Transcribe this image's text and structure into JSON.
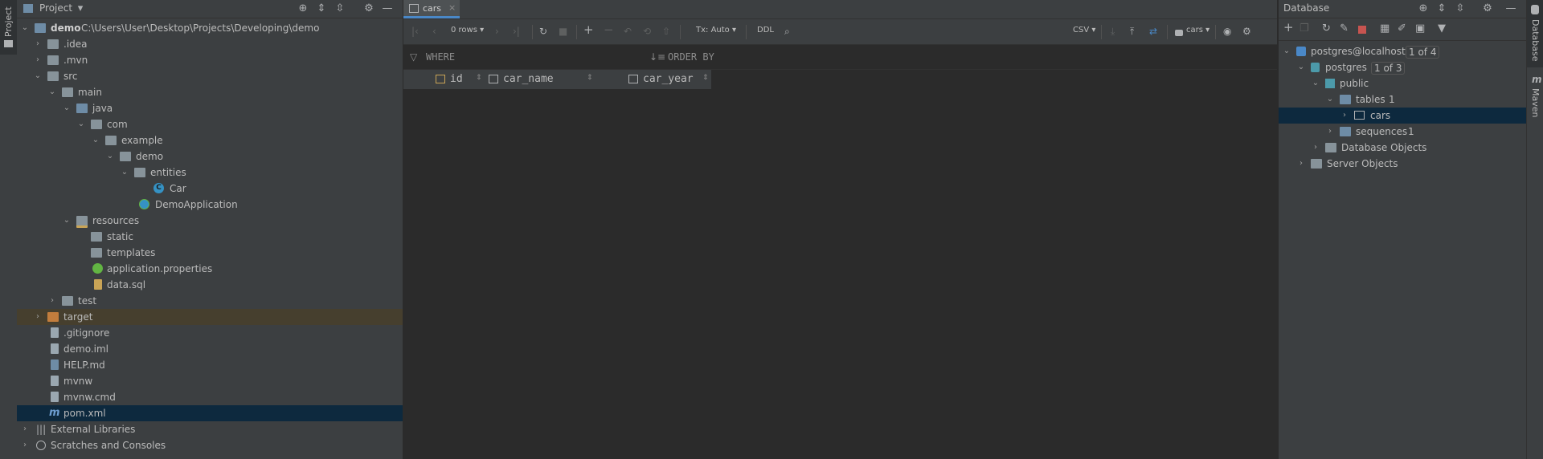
{
  "left_stripe": {
    "project_tab": "Project"
  },
  "project": {
    "title": "Project",
    "tree": [
      {
        "label": "demo",
        "hint": "C:\\Users\\User\\Desktop\\Projects\\Developing\\demo"
      },
      {
        "label": ".idea"
      },
      {
        "label": ".mvn"
      },
      {
        "label": "src"
      },
      {
        "label": "main"
      },
      {
        "label": "java"
      },
      {
        "label": "com"
      },
      {
        "label": "example"
      },
      {
        "label": "demo"
      },
      {
        "label": "entities"
      },
      {
        "label": "Car"
      },
      {
        "label": "DemoApplication"
      },
      {
        "label": "resources"
      },
      {
        "label": "static"
      },
      {
        "label": "templates"
      },
      {
        "label": "application.properties"
      },
      {
        "label": "data.sql"
      },
      {
        "label": "test"
      },
      {
        "label": "target"
      },
      {
        "label": ".gitignore"
      },
      {
        "label": "demo.iml"
      },
      {
        "label": "HELP.md"
      },
      {
        "label": "mvnw"
      },
      {
        "label": "mvnw.cmd"
      },
      {
        "label": "pom.xml"
      },
      {
        "label": "External Libraries"
      },
      {
        "label": "Scratches and Consoles"
      }
    ]
  },
  "editor": {
    "tab_label": "cars",
    "toolbar": {
      "rows": "0 rows",
      "tx": "Tx: Auto",
      "ddl": "DDL",
      "csv": "CSV",
      "datasource": "cars"
    },
    "filter": {
      "where": "WHERE",
      "order_by": "ORDER BY"
    },
    "columns": [
      "id",
      "car_name",
      "car_year"
    ]
  },
  "database": {
    "title": "Database",
    "tree": [
      {
        "label": "postgres@localhost",
        "hint": "1 of 4"
      },
      {
        "label": "postgres",
        "hint": "1 of 3"
      },
      {
        "label": "public"
      },
      {
        "label": "tables",
        "hint": "1"
      },
      {
        "label": "cars"
      },
      {
        "label": "sequences",
        "hint": "1"
      },
      {
        "label": "Database Objects"
      },
      {
        "label": "Server Objects"
      }
    ]
  },
  "right_stripe": {
    "database_tab": "Database",
    "maven_tab": "Maven"
  }
}
